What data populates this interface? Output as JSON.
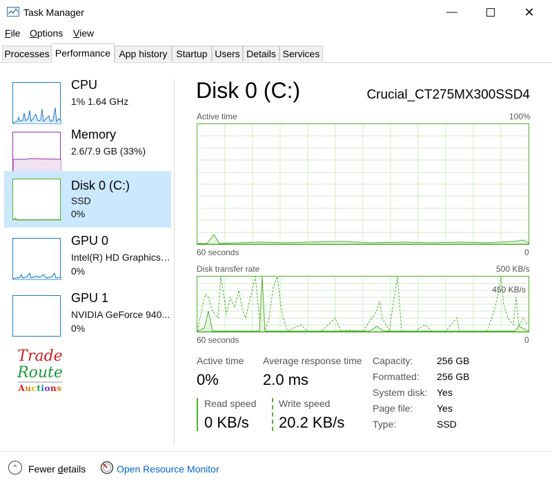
{
  "window": {
    "title": "Task Manager"
  },
  "menu": {
    "file": "File",
    "options": "Options",
    "view": "View"
  },
  "tabs": [
    {
      "label": "Processes"
    },
    {
      "label": "Performance",
      "active": true
    },
    {
      "label": "App history"
    },
    {
      "label": "Startup"
    },
    {
      "label": "Users"
    },
    {
      "label": "Details"
    },
    {
      "label": "Services"
    }
  ],
  "sidebar": {
    "items": [
      {
        "title": "CPU",
        "sub": "1%  1.64 GHz",
        "value": "",
        "color": "#1a79c8"
      },
      {
        "title": "Memory",
        "sub": "2.6/7.9 GB (33%)",
        "value": "",
        "color": "#9a2cb0"
      },
      {
        "title": "Disk 0 (C:)",
        "sub": "SSD",
        "value": "0%",
        "color": "#4caf2c"
      },
      {
        "title": "GPU 0",
        "sub": "Intel(R) HD Graphics ...",
        "value": "0%",
        "color": "#1a79c8"
      },
      {
        "title": "GPU 1",
        "sub": "NVIDIA GeForce 940...",
        "value": "0%",
        "color": "#1a79c8"
      }
    ]
  },
  "logo": {
    "line1": "Trade",
    "line2": "Route",
    "line3": "Auctions"
  },
  "main": {
    "title": "Disk 0 (C:)",
    "model": "Crucial_CT275MX300SSD4",
    "graph1": {
      "label": "Active time",
      "max": "100%",
      "time": "60 seconds",
      "min": "0"
    },
    "graph2": {
      "label": "Disk transfer rate",
      "max": "500 KB/s",
      "mid": "450 KB/s",
      "time": "60 seconds",
      "min": "0"
    },
    "stats": {
      "active_label": "Active time",
      "active_value": "0%",
      "response_label": "Average response time",
      "response_value": "2.0 ms",
      "read_label": "Read speed",
      "read_value": "0 KB/s",
      "write_label": "Write speed",
      "write_value": "20.2 KB/s"
    },
    "details": [
      {
        "label": "Capacity:",
        "value": "256 GB"
      },
      {
        "label": "Formatted:",
        "value": "256 GB"
      },
      {
        "label": "System disk:",
        "value": "Yes"
      },
      {
        "label": "Page file:",
        "value": "Yes"
      },
      {
        "label": "Type:",
        "value": "SSD"
      }
    ]
  },
  "footer": {
    "fewer": "Fewer details",
    "resource": "Open Resource Monitor"
  },
  "colors": {
    "accent": "#4caf2c",
    "selected": "#cce8ff",
    "link": "#0066cc"
  }
}
